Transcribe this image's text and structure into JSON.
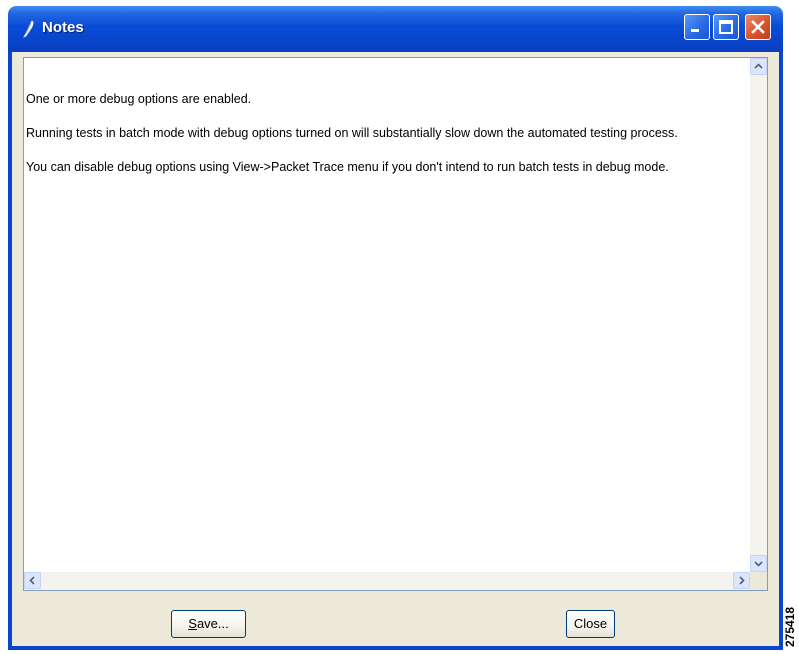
{
  "window": {
    "title": "Notes",
    "icon": "feather-pen-icon"
  },
  "titlebar_buttons": {
    "minimize_icon": "minimize-icon",
    "maximize_icon": "maximize-icon",
    "close_icon": "close-icon"
  },
  "notes": {
    "paragraphs": [
      "One or more debug options are enabled.",
      "Running tests in batch mode with debug options turned on will substantially slow down the automated testing process.",
      "You can disable debug options using View->Packet Trace menu if you don't intend to run batch tests in debug mode."
    ]
  },
  "buttons": {
    "save_mnemonic": "S",
    "save_rest": "ave...",
    "close_label": "Close"
  },
  "figure_id": "275418",
  "colors": {
    "titlebar": "#0846ce",
    "window_bg": "#ece9d8",
    "close_button": "#d9532b"
  }
}
